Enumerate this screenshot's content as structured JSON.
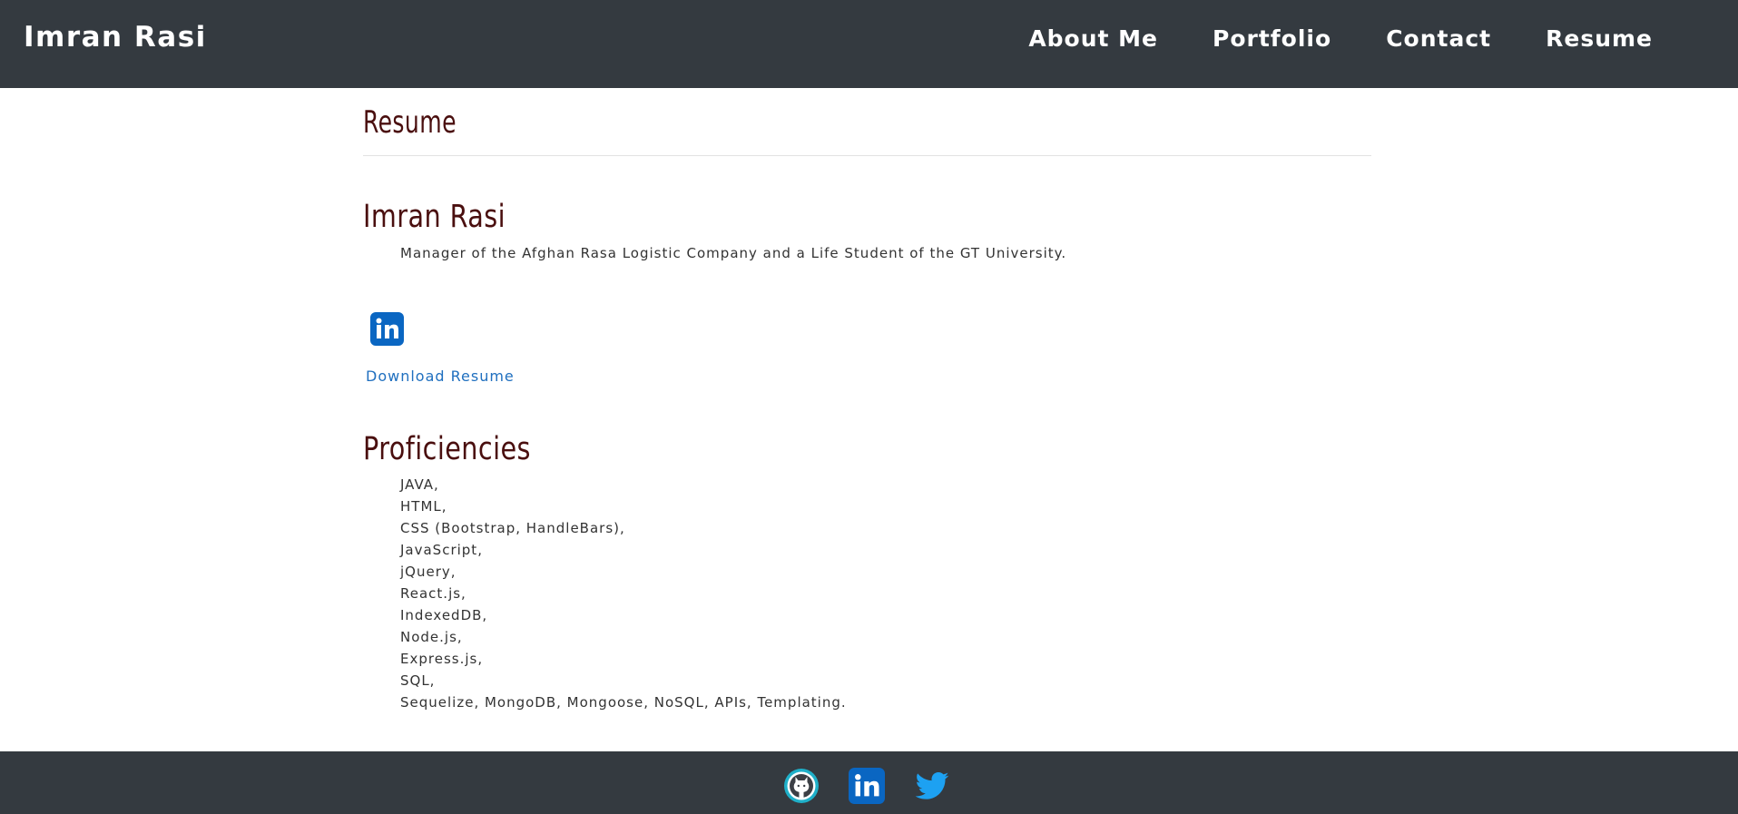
{
  "navbar": {
    "brand": "Imran Rasi",
    "links": [
      "About Me",
      "Portfolio",
      "Contact",
      "Resume"
    ]
  },
  "page": {
    "title": "Resume"
  },
  "profile": {
    "name": "Imran Rasi",
    "bio": "Manager of the Afghan Rasa Logistic Company and a Life Student of the GT University.",
    "linkedin_icon": "linkedin-icon",
    "download_label": "Download Resume"
  },
  "proficiencies": {
    "heading": "Proficiencies",
    "items": [
      "JAVA,",
      "HTML,",
      "CSS (Bootstrap, HandleBars),",
      "JavaScript,",
      "jQuery,",
      "React.js,",
      "IndexedDB,",
      "Node.js,",
      "Express.js,",
      "SQL,",
      "Sequelize, MongoDB, Mongoose, NoSQL, APIs, Templating."
    ]
  },
  "footer": {
    "icons": [
      "github-icon",
      "linkedin-icon",
      "twitter-icon"
    ]
  },
  "colors": {
    "navbar_bg": "#343a40",
    "heading": "#4a0f0f",
    "link": "#1f6fbf",
    "linkedin": "#0a66c2",
    "twitter": "#1da1f2"
  }
}
